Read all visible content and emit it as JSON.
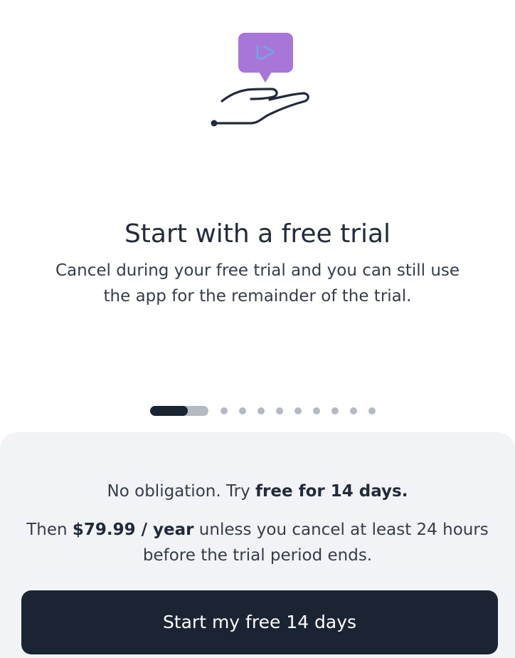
{
  "illustration": {
    "icon": "hand-offering-play-bubble-icon",
    "bubble_color": "#a875d8",
    "play_symbol_color": "#6ea8e8",
    "line_color": "#232b3b"
  },
  "onboarding": {
    "title": "Start with a free trial",
    "description": "Cancel during your free trial and you can still use the app for the remainder of the trial."
  },
  "pager": {
    "total_pages": 10,
    "current_page": 1,
    "current_progress": 0.65
  },
  "offer": {
    "line_prefix": "No obligation. Try ",
    "line_emphasis": "free for 14 days.",
    "price_prefix": "Then ",
    "price_emphasis": "$79.99 / year",
    "price_suffix": " unless you cancel at least 24 hours before the trial period ends."
  },
  "cta": {
    "label": "Start my free 14 days"
  },
  "colors": {
    "primary_dark": "#1b2433",
    "sheet_background": "#f2f3f6",
    "indicator_inactive": "#b5b9c1"
  }
}
